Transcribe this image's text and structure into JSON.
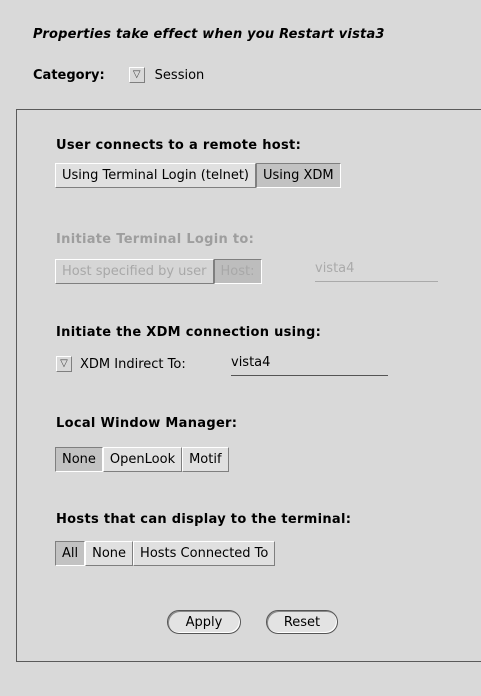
{
  "header": {
    "message": "Properties take effect when you Restart vista3",
    "category_label": "Category:",
    "category_value": "Session",
    "category_menu_glyph": "▽"
  },
  "sections": {
    "remote_host": {
      "title": "User connects to a remote host:",
      "options": [
        "Using Terminal Login (telnet)",
        "Using XDM"
      ],
      "selected": "Using XDM"
    },
    "terminal_login": {
      "title": "Initiate Terminal Login to:",
      "options": [
        "Host specified by user",
        "Host:"
      ],
      "selected": "Host:",
      "host_value": "vista4",
      "disabled": true
    },
    "xdm_connection": {
      "title": "Initiate the XDM connection using:",
      "menu_glyph": "▽",
      "label": "XDM Indirect To:",
      "value": "vista4"
    },
    "window_manager": {
      "title": "Local Window Manager:",
      "options": [
        "None",
        "OpenLook",
        "Motif"
      ],
      "selected": "None"
    },
    "hosts_display": {
      "title": "Hosts that can display to the terminal:",
      "options": [
        "All",
        "None",
        "Hosts Connected To"
      ],
      "selected": "All"
    }
  },
  "buttons": {
    "apply": "Apply",
    "reset": "Reset"
  },
  "colors": {
    "background": "#d9d9d9",
    "selected": "#c2c2c2",
    "disabled_text": "#9e9e9e"
  }
}
